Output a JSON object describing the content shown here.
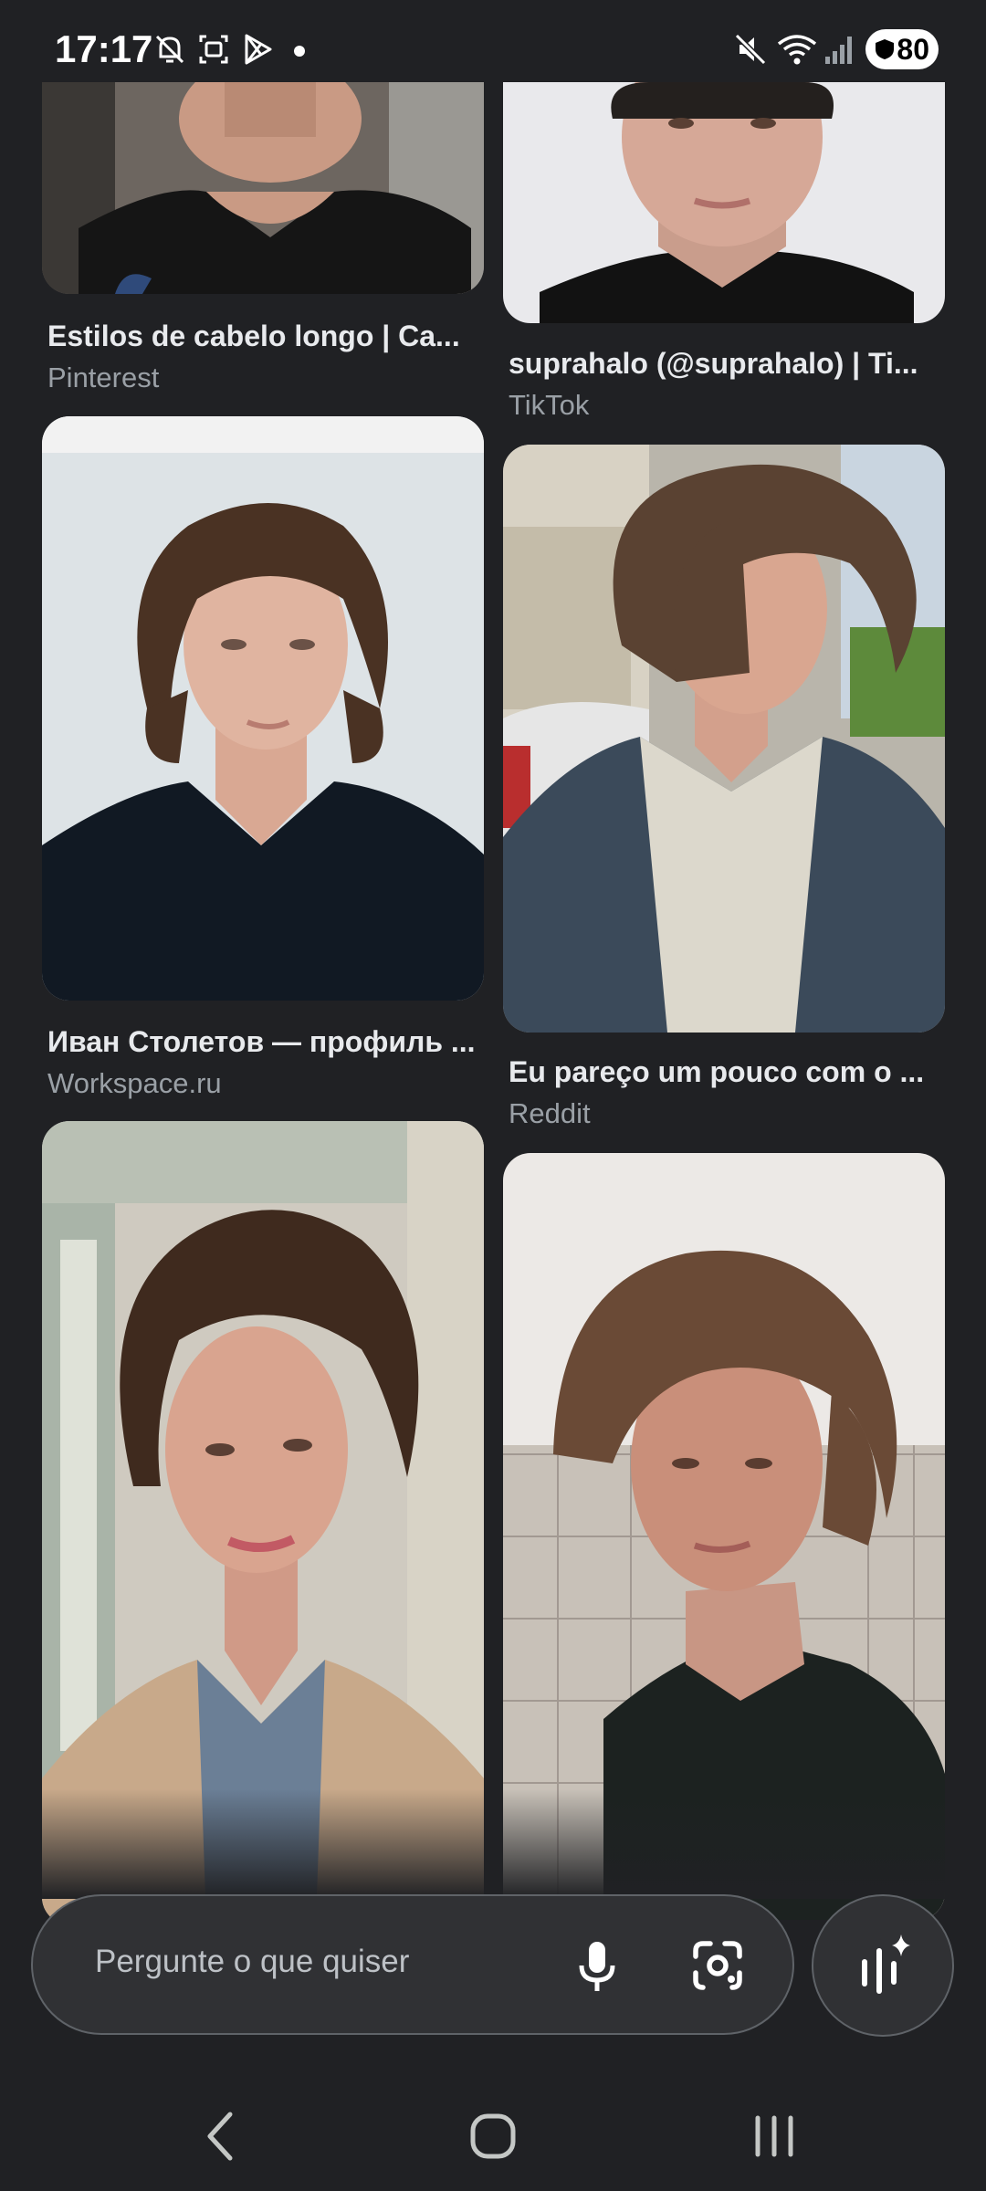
{
  "status_bar": {
    "time": "17:17",
    "battery": "80",
    "icons_left": [
      "notifications-off-icon",
      "screenshot-icon",
      "play-store-icon",
      "dot-icon"
    ],
    "icons_right": [
      "mute-icon",
      "wifi-icon",
      "signal-icon",
      "battery-icon"
    ]
  },
  "results": [
    {
      "title": "Estilos de cabelo longo | Ca...",
      "source": "Pinterest"
    },
    {
      "title": "suprahalo (@suprahalo) | Ti...",
      "source": "TikTok"
    },
    {
      "title": "Иван Столетов — профиль ...",
      "source": "Workspace.ru"
    },
    {
      "title": "Eu pareço um pouco com o ...",
      "source": "Reddit"
    },
    {
      "title": "",
      "source": ""
    },
    {
      "title": "",
      "source": ""
    }
  ],
  "search": {
    "placeholder": "Pergunte o que quiser"
  },
  "colors": {
    "background": "#202124",
    "surface": "#303134",
    "text_primary": "#e8eaed",
    "text_secondary": "#9aa0a6"
  }
}
